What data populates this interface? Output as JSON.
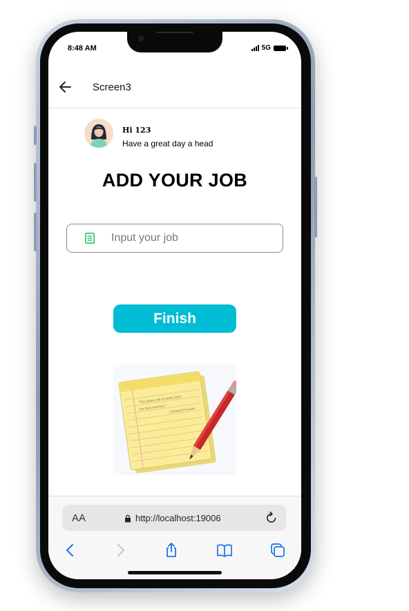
{
  "status": {
    "time": "8:48 AM",
    "network": "5G"
  },
  "appbar": {
    "title": "Screen3"
  },
  "greeting": {
    "name": "Hi 123",
    "message": "Have a great day a head"
  },
  "heading": "ADD YOUR JOB",
  "job_input": {
    "placeholder": "Input your job",
    "value": ""
  },
  "finish_button": {
    "label": "Finish"
  },
  "illustration": {
    "icon": "notepad-with-pencil",
    "note_text": "\"The palest ink is better than the best memory.\" - Chinese Proverb"
  },
  "browser": {
    "text_size_label": "AA",
    "url": "http://localhost:19006"
  },
  "colors": {
    "accent": "#00bcd4",
    "input_border": "#8a8a8a"
  }
}
